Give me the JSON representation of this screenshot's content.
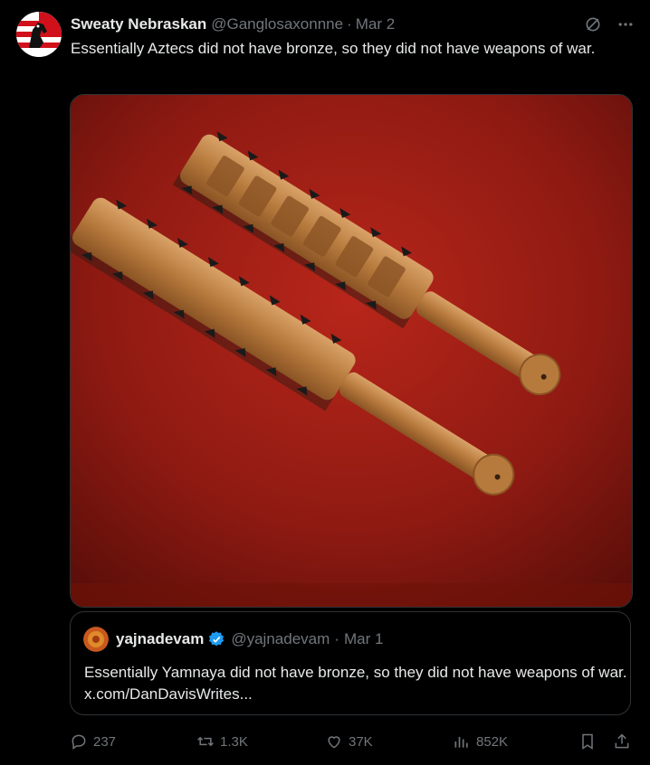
{
  "post": {
    "author_name": "Sweaty Nebraskan",
    "author_handle": "@Ganglosaxonnne",
    "separator": "·",
    "date": "Mar 2",
    "text": "Essentially Aztecs did not have bronze, so they did not have weapons of war.",
    "icons": {
      "grok": "grok-icon",
      "more": "more-icon"
    }
  },
  "quote": {
    "author_name": "yajnadevam",
    "author_handle": "@yajnadevam",
    "separator": "·",
    "date": "Mar 1",
    "text": "Essentially Yamnaya did not have bronze, so they did not have weapons of war. x.com/DanDavisWrites...",
    "verified_color": "#1d9bf0"
  },
  "actions": {
    "replies": "237",
    "reposts": "1.3K",
    "likes": "37K",
    "views": "852K"
  },
  "colors": {
    "background": "#000000",
    "text": "#e7e9ea",
    "muted": "#71767b",
    "border": "#2f3336"
  }
}
